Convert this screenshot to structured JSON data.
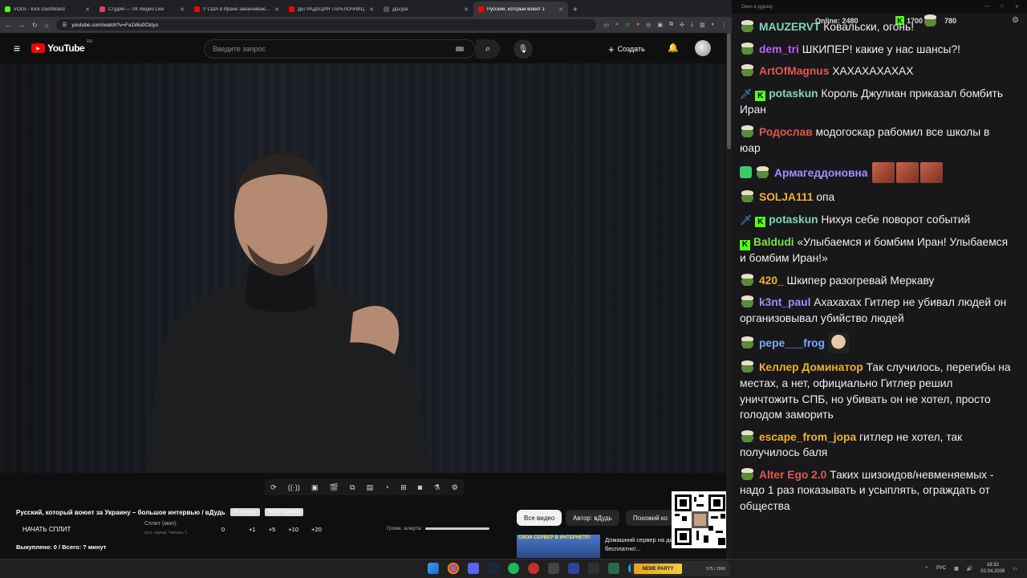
{
  "browser": {
    "tabs": [
      {
        "label": "VODs - Kick Dashboard",
        "color": "#53fc18"
      },
      {
        "label": "Студия — VK Видео Live",
        "color": "#e04060"
      },
      {
        "label": "У США в Иране заканчиваются",
        "color": "#ff0000"
      },
      {
        "label": "ДЕГРАДАЦИЯ ТАРЕЛОЧНИЦ",
        "color": "#ff0000"
      },
      {
        "label": "Д(ы)ра",
        "color": "#555555"
      },
      {
        "label": "Русский, который воюет з",
        "color": "#ff0000"
      }
    ],
    "url": "youtube.com/watch?v=Fa1Wu0Cktyo"
  },
  "youtube": {
    "logo_text": "YouTube",
    "region": "RU",
    "search_placeholder": "Введите запрос",
    "create_label": "Создать"
  },
  "panel": {
    "video_title": "Русский, который воюет за Украину – большое интервью / вДудь",
    "chip1": "На очереди",
    "chip2": "БЕЗПРЕДЗВАТЬ",
    "start_split": "НАЧАТЬ СПЛИТ",
    "split_label": "Сплит (мин):",
    "split_sub": "(уст. перед \"Начать\")",
    "split_values": [
      "0",
      "+1",
      "+5",
      "+10",
      "+20"
    ],
    "alert_label": "Громк. алерта:",
    "bought": "Выкуплено: 0 / Всего: ? минут"
  },
  "filters": {
    "all": "Все видео",
    "author": "Автор: вДудь",
    "similar": "Похожий ко"
  },
  "ad": {
    "thumb_text": "СВОЙ СЕРВЕР В ИНТЕРНЕТЕ!",
    "text": "Домашний сервер на динамическом IP бесплатно!..."
  },
  "chat": {
    "window_title": "Окно в дураку",
    "online_label": "Online: 2480",
    "kick_count": "1700",
    "pepe_count": "780",
    "messages": [
      {
        "user": "MAUZERVT",
        "color": "#7fd7b4",
        "text": "Ковальски, огонь!",
        "badge": "pepe"
      },
      {
        "user": "dem_tri",
        "color": "#c25cff",
        "text": "ШКИПЕР! какие у нас шансы?!",
        "badge": "pepe"
      },
      {
        "user": "ArtOfMagnus",
        "color": "#e0584a",
        "text": "ХАХАХАХАХАХ",
        "badge": "pepe"
      },
      {
        "user": "potaskun",
        "color": "#7fd7b4",
        "text": "Король Джулиан приказал бомбить Иран",
        "badge": "sword-kick"
      },
      {
        "user": "Родослав",
        "color": "#e0584a",
        "text": "модогоскар рабомил все школы в юар",
        "badge": "pepe"
      },
      {
        "user": "Армагеддоновна",
        "color": "#a48cff",
        "text": "",
        "badge": "shield-pepe",
        "emotes": 3
      },
      {
        "user": "SOLJA111",
        "color": "#f0b030",
        "text": "опа",
        "badge": "pepe"
      },
      {
        "user": "potaskun",
        "color": "#7fd7b4",
        "text": "Нихуя себе поворот событий",
        "badge": "sword-kick"
      },
      {
        "user": "Baldudi",
        "color": "#7fe04a",
        "text": "«Улыбаемся и бомбим Иран! Улыбаемся и бомбим Иран!»",
        "badge": "kick"
      },
      {
        "user": "420_",
        "color": "#f0b030",
        "text": "Шкипер разогревай Меркаву",
        "badge": "pepe"
      },
      {
        "user": "k3nt_paul",
        "color": "#a48cff",
        "text": "Ахахахах Гитлер не убивал людей он организовывал убийство людей",
        "badge": "pepe"
      },
      {
        "user": "pepe___frog",
        "color": "#7aa8ff",
        "text": "",
        "badge": "pepe",
        "face": true
      },
      {
        "user": "Келлер Доминатор",
        "color": "#f0b030",
        "text": "Так случилось, перегибы на местах, а нет, официально Гитлер решил уничтожить СПБ, но убивать он не хотел, просто голодом заморить",
        "badge": "pepe"
      },
      {
        "user": "escape_from_jopa",
        "color": "#f0b030",
        "text": "гитлер не хотел, так получилось баля",
        "badge": "pepe"
      },
      {
        "user": "Alter Ego 2.0",
        "color": "#e0584a",
        "text": "Таких шизоидов/невменяемых - надо 1 раз показывать и усыплять, ограждать от общества",
        "badge": "pepe"
      }
    ]
  },
  "taskbar": {
    "mini_label": "NEME PARTY",
    "mini_count": "575 / 1590",
    "lang": "РУС",
    "time": "18:32",
    "date": "02.04.2026"
  }
}
